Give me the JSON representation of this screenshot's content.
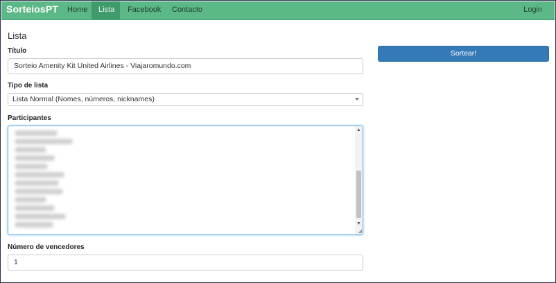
{
  "navbar": {
    "brand": "SorteiosPT",
    "items": [
      {
        "label": "Home",
        "active": false
      },
      {
        "label": "Lista",
        "active": true
      },
      {
        "label": "Facebook",
        "active": false
      },
      {
        "label": "Contacto",
        "active": false
      }
    ],
    "login_label": "Login",
    "color": "#5cb886",
    "active_color": "#3f9b6b"
  },
  "main": {
    "page_title": "Lista",
    "titulo": {
      "label": "Título",
      "value": "Sorteio Amenity Kit United Airlines - Viajaromundo.com"
    },
    "tipo_lista": {
      "label": "Tipo de lista",
      "selected": "Lista Normal (Nomes, números, nicknames)"
    },
    "participantes": {
      "label": "Participantes"
    },
    "vencedores": {
      "label": "Número de vencedores",
      "value": "1"
    }
  },
  "actions": {
    "sortear_label": "Sortear!",
    "button_color": "#337ab7"
  },
  "icons": {
    "select_arrow": "chevron-down-icon",
    "scroll_up": "scroll-up-arrow-icon",
    "scroll_down": "scroll-down-arrow-icon",
    "resize": "resize-grip-icon"
  }
}
